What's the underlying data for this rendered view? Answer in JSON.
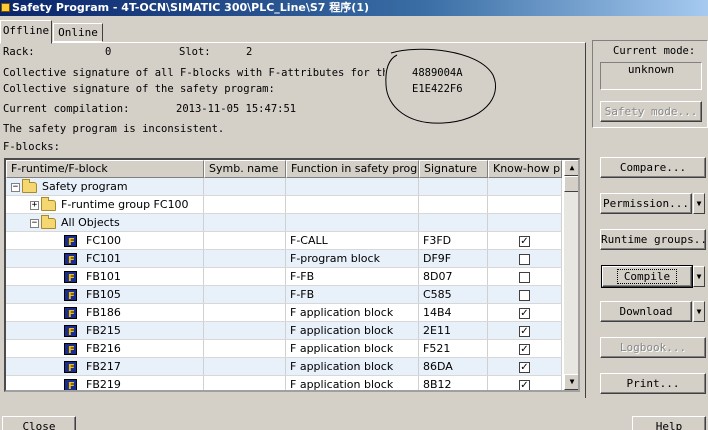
{
  "window": {
    "title": "Safety Program - 4T-OCN\\SIMATIC 300\\PLC_Line\\S7 程序(1)"
  },
  "tabs": [
    {
      "label": "Offline"
    },
    {
      "label": "Online"
    }
  ],
  "info": {
    "rack_label": "Rack:",
    "rack_value": "0",
    "slot_label": "Slot:",
    "slot_value": "2",
    "collective_fblocks_label": "Collective signature of all F-blocks with F-attributes for the b",
    "collective_fblocks_value": "4889004A",
    "collective_program_label": "Collective signature of the safety program:",
    "collective_program_value": "E1E422F6",
    "compilation_label": "Current compilation:",
    "compilation_value": "2013-11-05 15:47:51",
    "status_text": "The safety program is inconsistent.",
    "fblocks_label": "F-blocks:"
  },
  "table": {
    "headers": [
      "F-runtime/F-block",
      "Symb. name",
      "Function in safety program",
      "Signature",
      "Know-how p"
    ],
    "rows": [
      {
        "name": "Safety program",
        "symb": "",
        "function": "",
        "signature": "",
        "know_how": null
      },
      {
        "name": "F-runtime group FC100",
        "symb": "",
        "function": "",
        "signature": "",
        "know_how": null
      },
      {
        "name": "All Objects",
        "symb": "",
        "function": "",
        "signature": "",
        "know_how": null
      },
      {
        "name": "FC100",
        "symb": "",
        "function": "F-CALL",
        "signature": "F3FD",
        "know_how": true
      },
      {
        "name": "FC101",
        "symb": "",
        "function": "F-program block",
        "signature": "DF9F",
        "know_how": false
      },
      {
        "name": "FB101",
        "symb": "",
        "function": "F-FB",
        "signature": "8D07",
        "know_how": false
      },
      {
        "name": "FB105",
        "symb": "",
        "function": "F-FB",
        "signature": "C585",
        "know_how": false
      },
      {
        "name": "FB186",
        "symb": "",
        "function": "F application block",
        "signature": "14B4",
        "know_how": true
      },
      {
        "name": "FB215",
        "symb": "",
        "function": "F application block",
        "signature": "2E11",
        "know_how": true
      },
      {
        "name": "FB216",
        "symb": "",
        "function": "F application block",
        "signature": "F521",
        "know_how": true
      },
      {
        "name": "FB217",
        "symb": "",
        "function": "F application block",
        "signature": "86DA",
        "know_how": true
      },
      {
        "name": "FB219",
        "symb": "",
        "function": "F application block",
        "signature": "8B12",
        "know_how": true
      }
    ]
  },
  "side": {
    "current_mode_label": "Current mode:",
    "current_mode_value": "unknown",
    "safety_mode": "Safety mode...",
    "compare": "Compare...",
    "permission": "Permission...",
    "runtime_groups": "Runtime groups...",
    "compile": "Compile",
    "download": "Download",
    "logbook": "Logbook...",
    "print": "Print..."
  },
  "footer": {
    "close": "Close",
    "help": "Help"
  },
  "colors": {
    "title_bar": "#0a246a",
    "alt_row": "#e8f0fa",
    "dialog_bg": "#d4d0c8"
  }
}
